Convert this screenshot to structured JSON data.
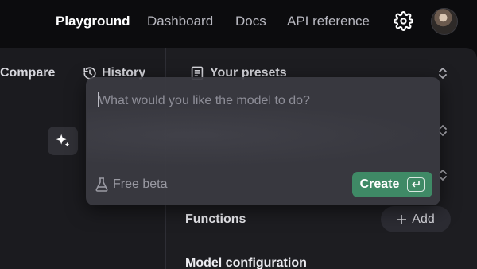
{
  "nav": {
    "items": [
      {
        "label": "Playground",
        "active": true
      },
      {
        "label": "Dashboard",
        "active": false
      },
      {
        "label": "Docs",
        "active": false
      },
      {
        "label": "API reference",
        "active": false
      }
    ],
    "settings_icon": "gear-icon",
    "avatar_icon": "user-avatar"
  },
  "toolbar": {
    "compare_label": "Compare",
    "history_label": "History",
    "history_icon": "history-clock-icon",
    "presets_label": "Your presets",
    "presets_icon": "document-icon"
  },
  "prompt_popover": {
    "placeholder": "What would you like the model to do?",
    "value": "",
    "badge_label": "Free beta",
    "badge_icon": "flask-icon",
    "create_label": "Create",
    "create_icon": "enter-key-icon"
  },
  "sidebar": {
    "functions_label": "Functions",
    "add_label": "Add",
    "model_config_label": "Model configuration"
  },
  "colors": {
    "background": "#0c0c0e",
    "panel": "#1d1d21",
    "popover": "#3a3a42",
    "accent_green": "#3f8a66"
  }
}
